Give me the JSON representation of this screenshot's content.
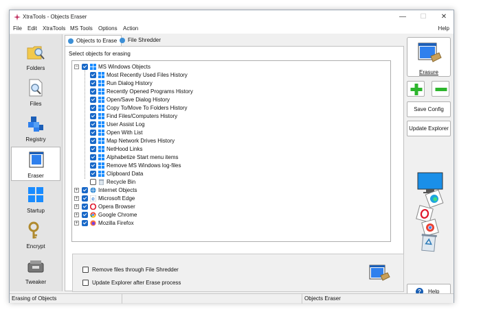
{
  "window": {
    "title": "XtraTools - Objects Eraser",
    "minimize": "—",
    "maximize": "☐",
    "close": "✕"
  },
  "menu": {
    "items": [
      "File",
      "Edit",
      "XtraTools",
      "MS Tools",
      "Options",
      "Action"
    ],
    "help": "Help"
  },
  "sidebar": {
    "items": [
      {
        "label": "Folders",
        "icon": "folder-search-icon"
      },
      {
        "label": "Files",
        "icon": "file-search-icon"
      },
      {
        "label": "Registry",
        "icon": "registry-cubes-icon"
      },
      {
        "label": "Eraser",
        "icon": "eraser-window-icon",
        "active": true
      },
      {
        "label": "Startup",
        "icon": "windows-logo-icon"
      },
      {
        "label": "Encrypt",
        "icon": "key-icon"
      },
      {
        "label": "Tweaker",
        "icon": "tweaker-tools-icon"
      }
    ]
  },
  "tabs": [
    {
      "label": "Objects to Erase",
      "active": true
    },
    {
      "label": "File Shredder",
      "active": false
    }
  ],
  "content": {
    "group_label": "Select objects for erasing",
    "tree": {
      "root": {
        "label": "MS Windows Objects",
        "checked": true,
        "expanded": true
      },
      "children": [
        {
          "label": "Most Recently Used Files History",
          "checked": true
        },
        {
          "label": "Run Dialog History",
          "checked": true
        },
        {
          "label": "Recently Opened Programs History",
          "checked": true
        },
        {
          "label": "Open/Save Dialog History",
          "checked": true
        },
        {
          "label": "Copy To/Move To Folders History",
          "checked": true
        },
        {
          "label": "Find Files/Computers History",
          "checked": true
        },
        {
          "label": "User Assist Log",
          "checked": true
        },
        {
          "label": "Open With List",
          "checked": true
        },
        {
          "label": "Map Network Drives History",
          "checked": true
        },
        {
          "label": "NetHood Links",
          "checked": true
        },
        {
          "label": "Alphabetize Start menu items",
          "checked": true
        },
        {
          "label": "Remove MS Windows log-files",
          "checked": true
        },
        {
          "label": "Clipboard Data",
          "checked": true
        },
        {
          "label": "Recycle Bin",
          "checked": false
        }
      ],
      "others": [
        {
          "label": "Internet Objects",
          "checked": true,
          "icon": "internet-globe-icon"
        },
        {
          "label": "Microsoft Edge",
          "checked": true,
          "icon": "edge-icon"
        },
        {
          "label": "Opera Browser",
          "checked": true,
          "icon": "opera-icon"
        },
        {
          "label": "Google Chrome",
          "checked": true,
          "icon": "chrome-icon"
        },
        {
          "label": "Mozilla Firefox",
          "checked": true,
          "icon": "firefox-icon"
        }
      ]
    },
    "options": [
      {
        "label": "Remove files through File Shredder",
        "checked": false
      },
      {
        "label": "Update Explorer after Erase process",
        "checked": false
      }
    ]
  },
  "rightpanel": {
    "erasure_label": "Erasure",
    "save_config": "Save Config",
    "update_explorer": "Update Explorer",
    "help": "Help"
  },
  "status": {
    "left": "Erasing of Objects",
    "middle": "",
    "right": "Objects Eraser"
  },
  "colors": {
    "accent": "#1868c8",
    "window_bg": "#f0f0f0",
    "plus_green": "#2db52d",
    "minus_green": "#2db52d"
  }
}
